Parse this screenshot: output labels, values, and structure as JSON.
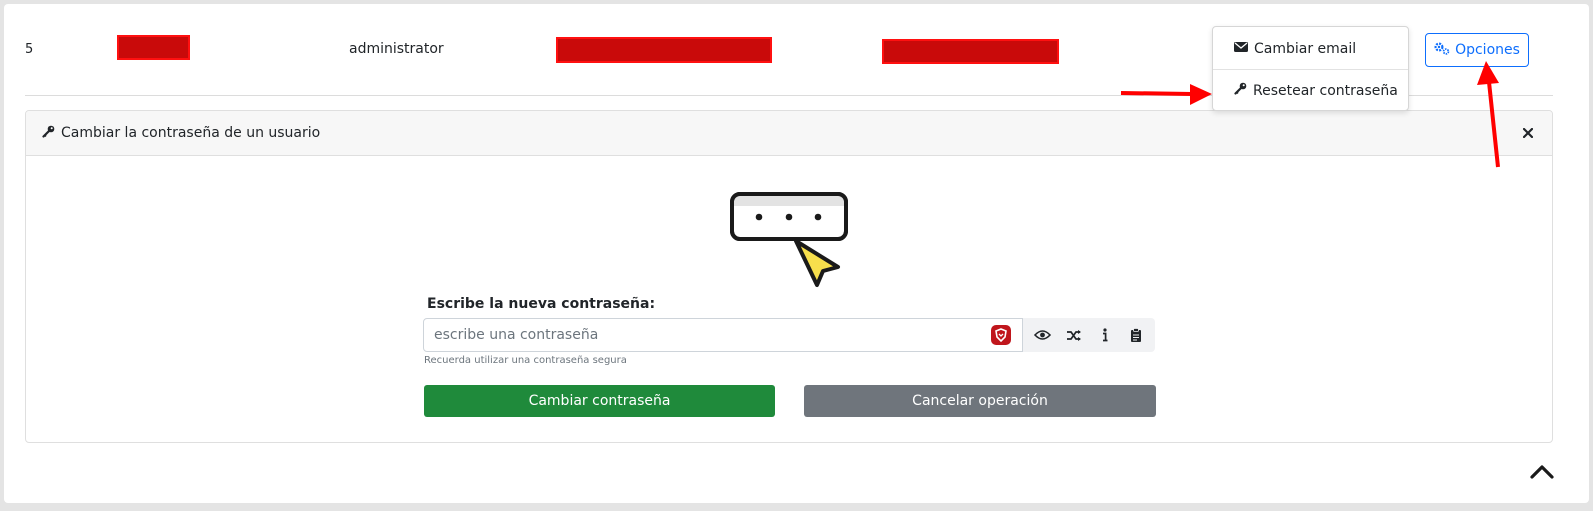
{
  "row": {
    "id": "5",
    "role": "administrator"
  },
  "actions": {
    "options_label": "Opciones",
    "menu": [
      {
        "label": "Cambiar email",
        "icon": "envelope-icon"
      },
      {
        "label": "Resetear contraseña",
        "icon": "key-icon"
      }
    ]
  },
  "panel": {
    "title": "Cambiar la contraseña de un usuario",
    "close_icon": "close-icon"
  },
  "form": {
    "label": "Escribe la nueva contraseña:",
    "placeholder": "escribe una contraseña",
    "help": "Recuerda utilizar una contraseña segura",
    "addons": [
      "eye-icon",
      "shuffle-icon",
      "info-icon",
      "clipboard-icon"
    ],
    "submit_label": "Cambiar contraseña",
    "cancel_label": "Cancelar operación"
  },
  "colors": {
    "primary": "#0d6efd",
    "success": "#1f8a3b",
    "secondary": "#6f757c",
    "annotation_arrow": "#ff0000",
    "redaction": "#c90a0a"
  }
}
